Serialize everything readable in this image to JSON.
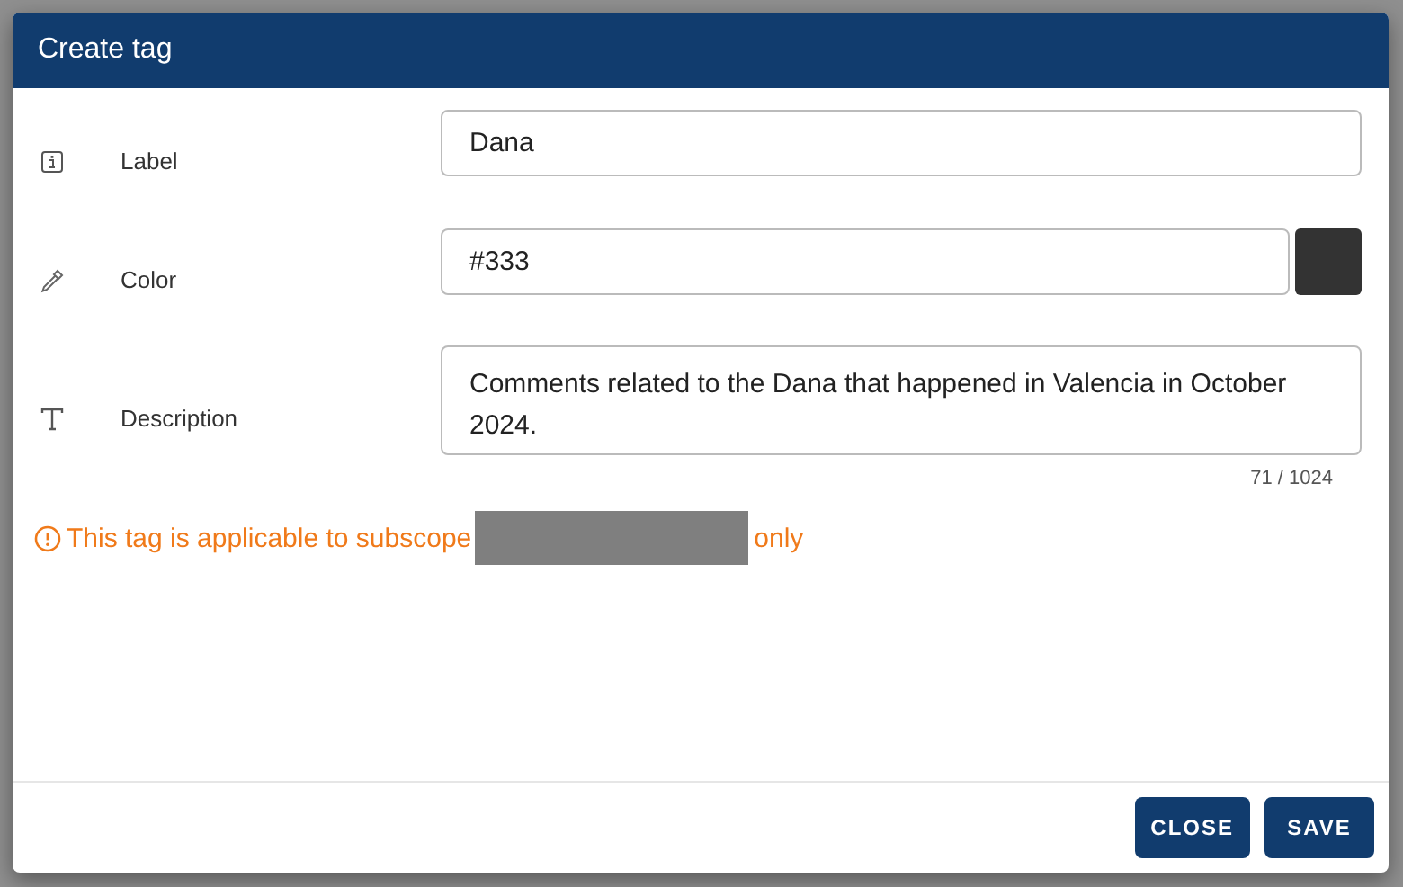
{
  "dialog": {
    "title": "Create tag",
    "fields": [
      {
        "kind": "text",
        "label": "Label",
        "value": "Dana"
      },
      {
        "kind": "color",
        "label": "Color",
        "value": "#333"
      },
      {
        "kind": "textarea",
        "label": "Description",
        "value": "Comments related to the Dana that happened in Valencia in October 2024.",
        "counter": "71 / 1024"
      }
    ],
    "warning": {
      "before": "This tag is applicable to subscope",
      "after": "only"
    },
    "buttons": [
      "CLOSE",
      "SAVE"
    ]
  }
}
